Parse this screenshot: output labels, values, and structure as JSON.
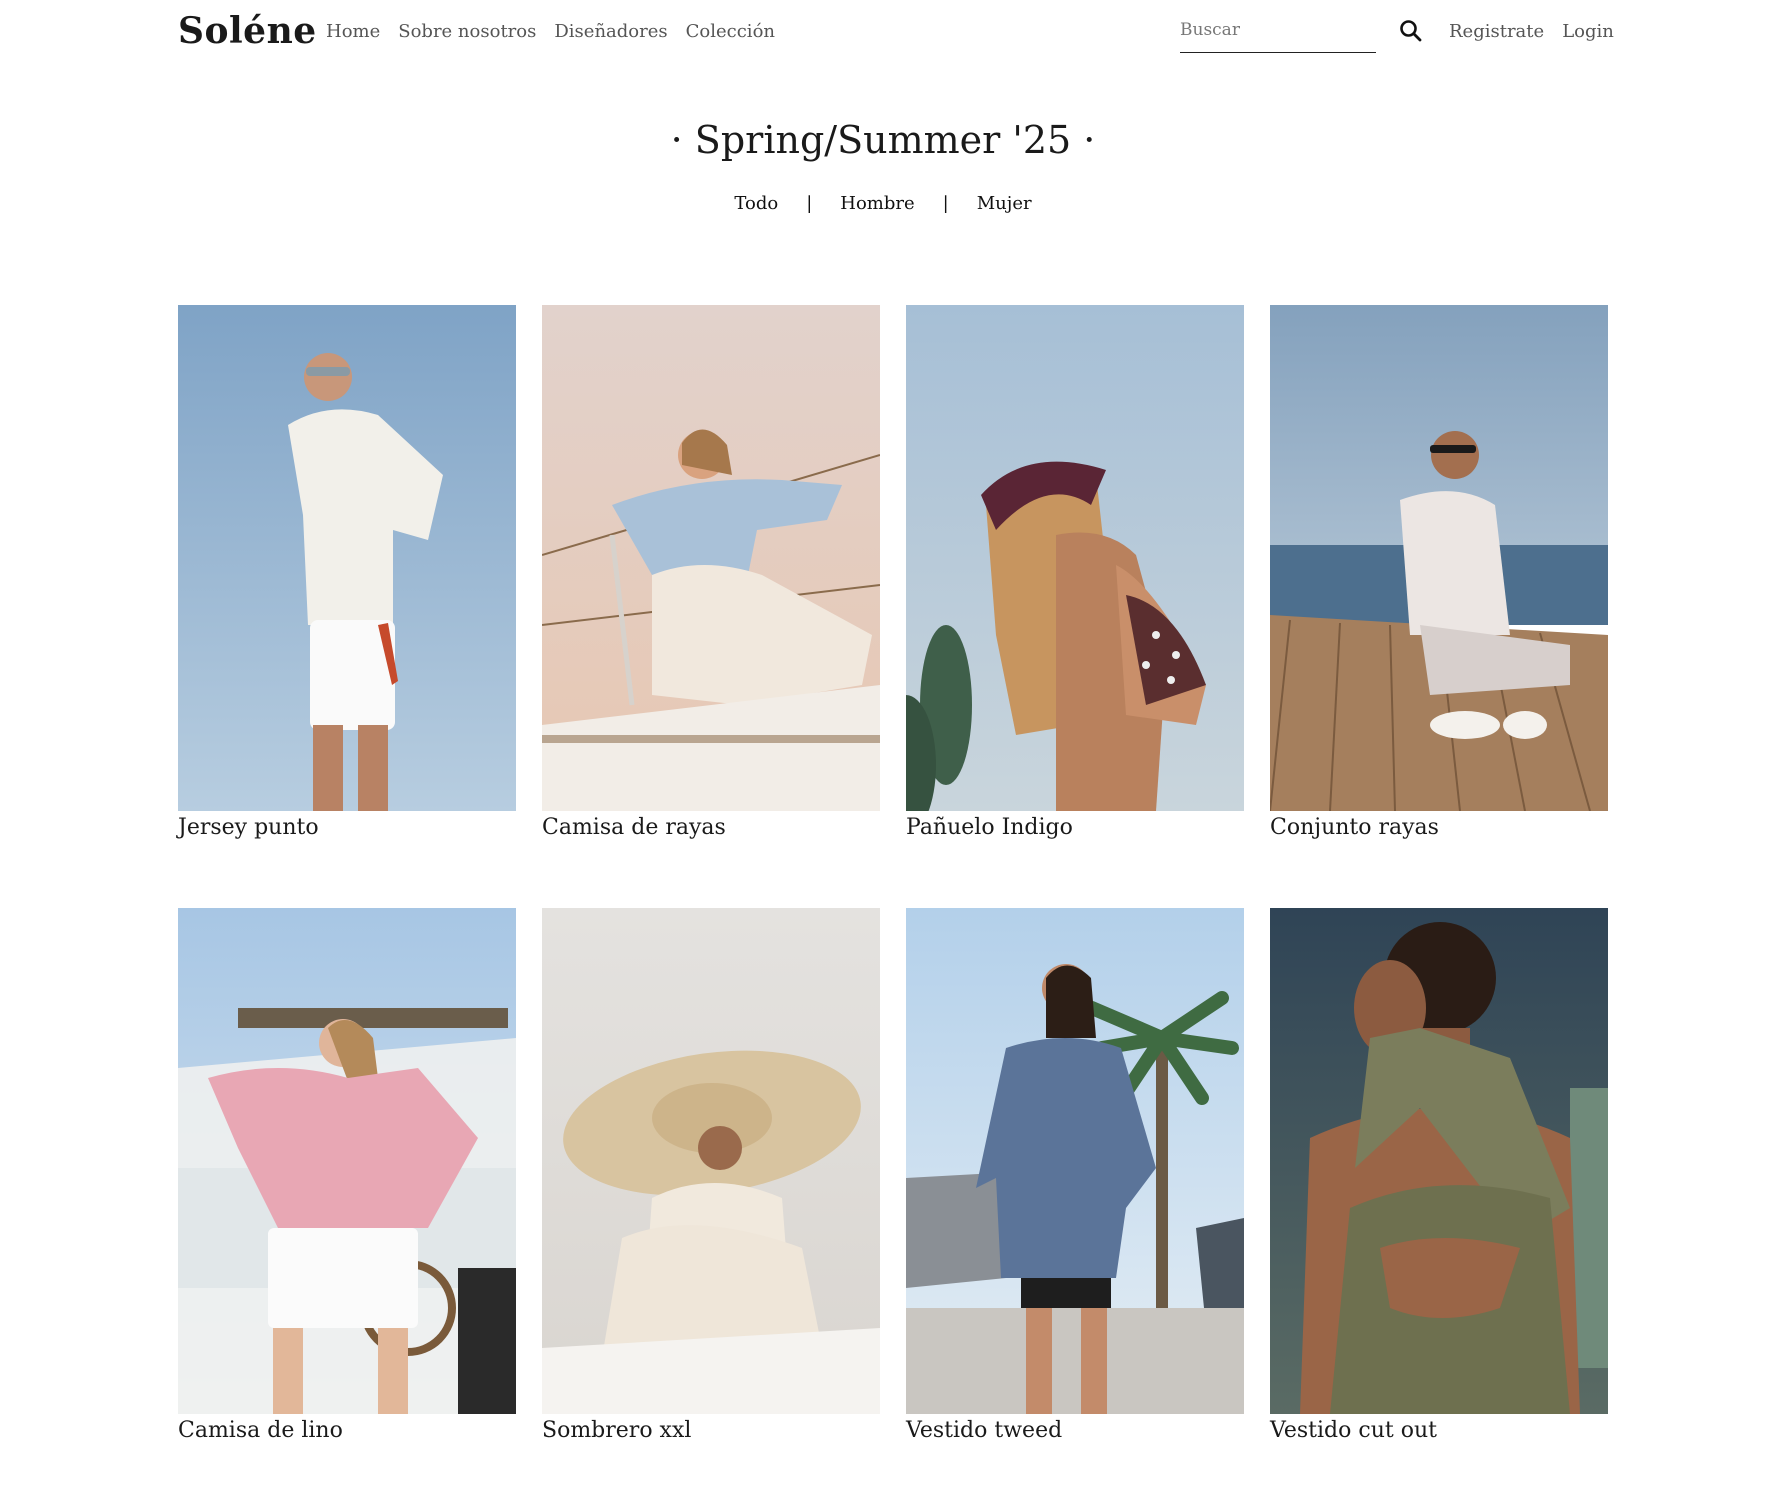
{
  "nav": {
    "brand": "Soléne",
    "links": [
      "Home",
      "Sobre nosotros",
      "Diseñadores",
      "Colección"
    ],
    "search_placeholder": "Buscar",
    "register": "Registrate",
    "login": "Login"
  },
  "collection": {
    "title": "· Spring/Summer '25 ·",
    "filters": [
      "Todo",
      "Hombre",
      "Mujer"
    ],
    "separator": "|"
  },
  "products": [
    {
      "name": "Jersey punto",
      "icon": "photo-man-knit-sweater",
      "sky": "#8fb0cf",
      "accent": "#f1efe9"
    },
    {
      "name": "Camisa de rayas",
      "icon": "photo-woman-striped-shirt-boat",
      "sky": "#e2cfc6",
      "accent": "#9fb7d0"
    },
    {
      "name": "Pañuelo Indigo",
      "icon": "photo-woman-headscarf-bikini",
      "sky": "#a9c4d8",
      "accent": "#5a2a36"
    },
    {
      "name": "Conjunto rayas",
      "icon": "photo-man-striped-set-deck",
      "sky": "#8ea9c4",
      "accent": "#b98a5a"
    },
    {
      "name": "Camisa de lino",
      "icon": "photo-woman-pink-linen-shirt",
      "sky": "#b9d2e8",
      "accent": "#e7a5b5"
    },
    {
      "name": "Sombrero xxl",
      "icon": "photo-woman-xxl-straw-hat",
      "sky": "#e6e3df",
      "accent": "#d9c6a3"
    },
    {
      "name": "Vestido tweed",
      "icon": "photo-woman-tweed-dress-palm",
      "sky": "#bcd6ec",
      "accent": "#4f6a8c"
    },
    {
      "name": "Vestido cut out",
      "icon": "photo-woman-cutout-dress",
      "sky": "#3e5468",
      "accent": "#6f7152"
    }
  ]
}
